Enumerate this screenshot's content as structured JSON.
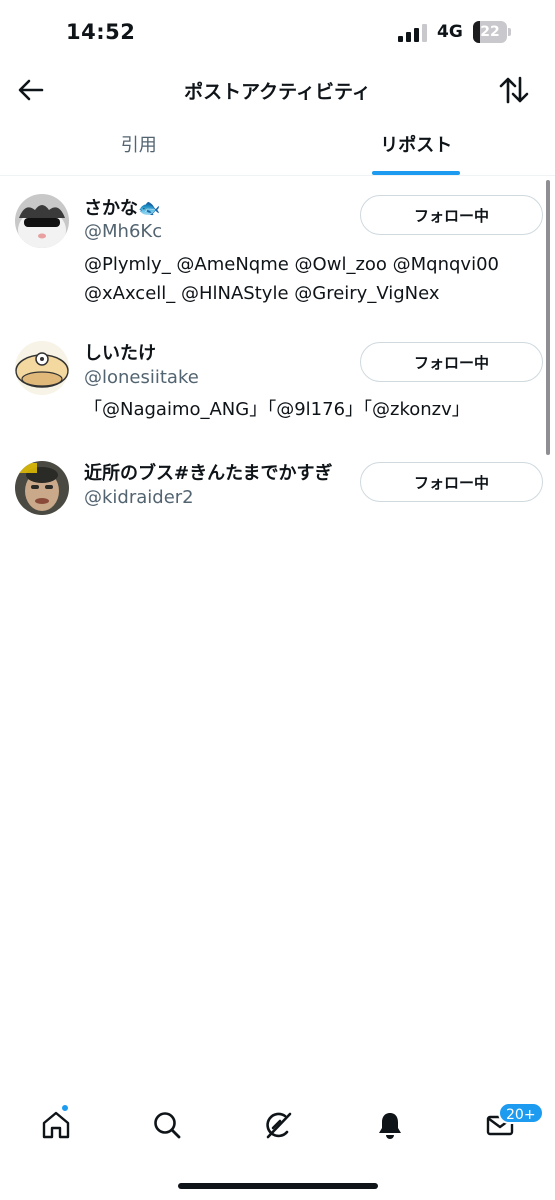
{
  "status_bar": {
    "time": "14:52",
    "network": "4G",
    "battery_level": 22,
    "battery_label": "22"
  },
  "header": {
    "title": "ポストアクティビティ",
    "back_icon": "arrow-left-icon",
    "sort_icon": "sort-arrows-icon"
  },
  "tabs": [
    {
      "label": "引用",
      "active": false
    },
    {
      "label": "リポスト",
      "active": true
    }
  ],
  "users": [
    {
      "name": "さかな",
      "emoji": "🐟",
      "handle": "@Mh6Kc",
      "bio": "@Plymly_ @AmeNqme @Owl_zoo @Mqnqvi00 @xAxcell_ @HlNAStyle @Greiry_VigNex",
      "button_label": "フォロー中"
    },
    {
      "name": "しいたけ",
      "handle": "@lonesiitake",
      "bio": "「@Nagaimo_ANG」「@9l176」「@zkonzv」",
      "button_label": "フォロー中"
    },
    {
      "name": "近所のブス#きんたまでかすぎ",
      "handle": "@kidraider2",
      "bio": "",
      "button_label": "フォロー中"
    }
  ],
  "bottom_nav": {
    "items": [
      "home-icon",
      "search-icon",
      "grok-icon",
      "notifications-icon",
      "messages-icon"
    ],
    "messages_badge": "20+"
  },
  "colors": {
    "accent": "#1d9bf0",
    "text_primary": "#0f1419",
    "text_secondary": "#536471",
    "border": "#cfd9de"
  }
}
